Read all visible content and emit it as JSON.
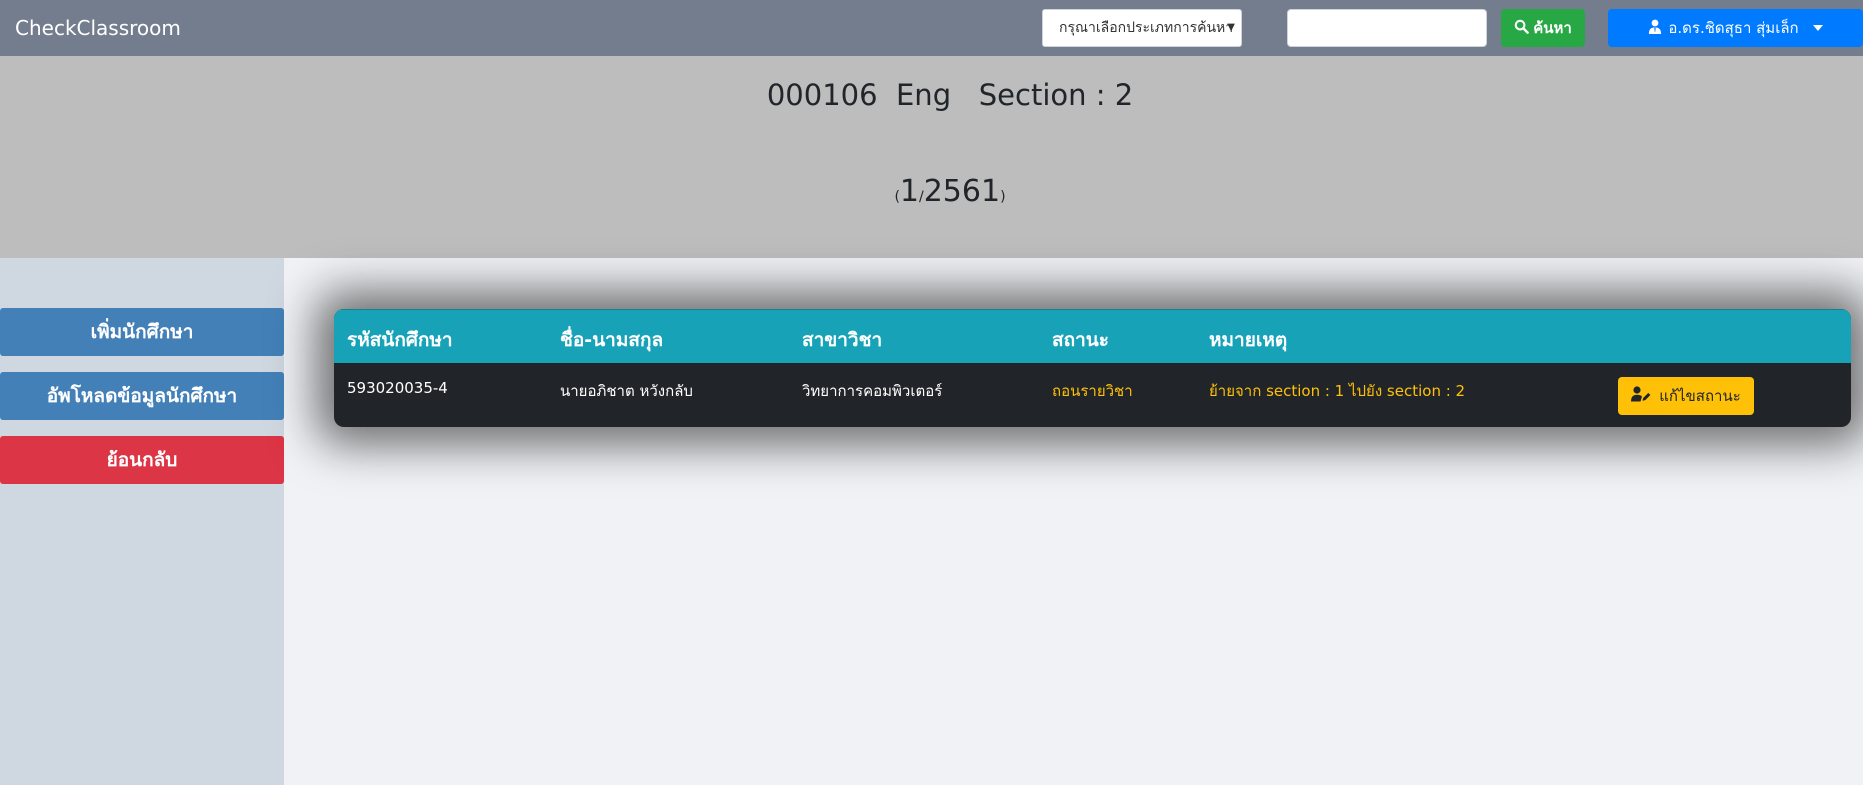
{
  "app": {
    "brand": "CheckClassroom"
  },
  "navbar": {
    "search_type": {
      "selected": "กรุณาเลือกประเภทการค้นหา",
      "icon": "chevron-down-icon"
    },
    "search_input": {
      "value": "",
      "placeholder": ""
    },
    "search_button": {
      "label": "ค้นหา",
      "icon": "search-icon",
      "color": "#28a745"
    },
    "user_menu": {
      "label": "อ.ดร.ชิดสุธา สุ่มเล็ก",
      "icon": "user-tie-icon",
      "color": "#007bff"
    }
  },
  "header": {
    "course_title": "000106  Eng   Section : 2",
    "term_open": "(",
    "term": "1",
    "term_sep": "/",
    "year": "2561",
    "term_close": ")"
  },
  "sidebar": {
    "buttons": [
      {
        "label": "เพิ่มนักศึกษา",
        "color": "#4380b8"
      },
      {
        "label": "อัพโหลดข้อมูลนักศึกษา",
        "color": "#4380b8"
      },
      {
        "label": "ย้อนกลับ",
        "color": "#dc3545"
      }
    ]
  },
  "table": {
    "columns": [
      "รหัสนักศึกษา",
      "ชื่อ-นามสกุล",
      "สาขาวิชา",
      "สถานะ",
      "หมายเหตุ"
    ],
    "rows": [
      {
        "student_id": "593020035-4",
        "name": "นายอภิชาต หวังกลับ",
        "major": "วิทยาการคอมพิวเตอร์",
        "status": "ถอนรายวิชา",
        "note": "ย้ายจาก section : 1 ไปยัง section : 2",
        "action_label": "แก้ไขสถานะ",
        "action_icon": "user-edit-icon"
      }
    ],
    "header_color": "#17a2b8",
    "warning_color": "#ffc107"
  }
}
